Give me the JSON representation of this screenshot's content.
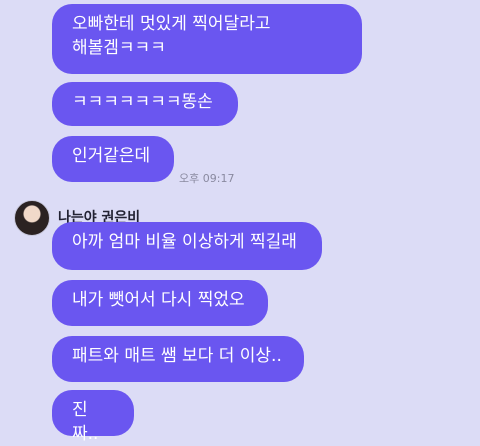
{
  "messages_group1": [
    {
      "text": "오빠한테 멋있게 찍어달라고\n해볼겜ㅋㅋㅋ"
    },
    {
      "text": "ㅋㅋㅋㅋㅋㅋㅋ똥손"
    },
    {
      "text": "인거같은데"
    }
  ],
  "group1_time": "오후 09:17",
  "sender": {
    "name": "나는야 권은비"
  },
  "messages_group2": [
    {
      "text": "아까 엄마 비율 이상하게 찍길래"
    },
    {
      "text": "내가 뺏어서 다시 찍었오"
    },
    {
      "text": "패트와 매트 쌤 보다 더 이상.."
    },
    {
      "text": "진짜.."
    }
  ],
  "colors": {
    "bubble": "#6a56f0",
    "background": "#dcdcf6"
  }
}
